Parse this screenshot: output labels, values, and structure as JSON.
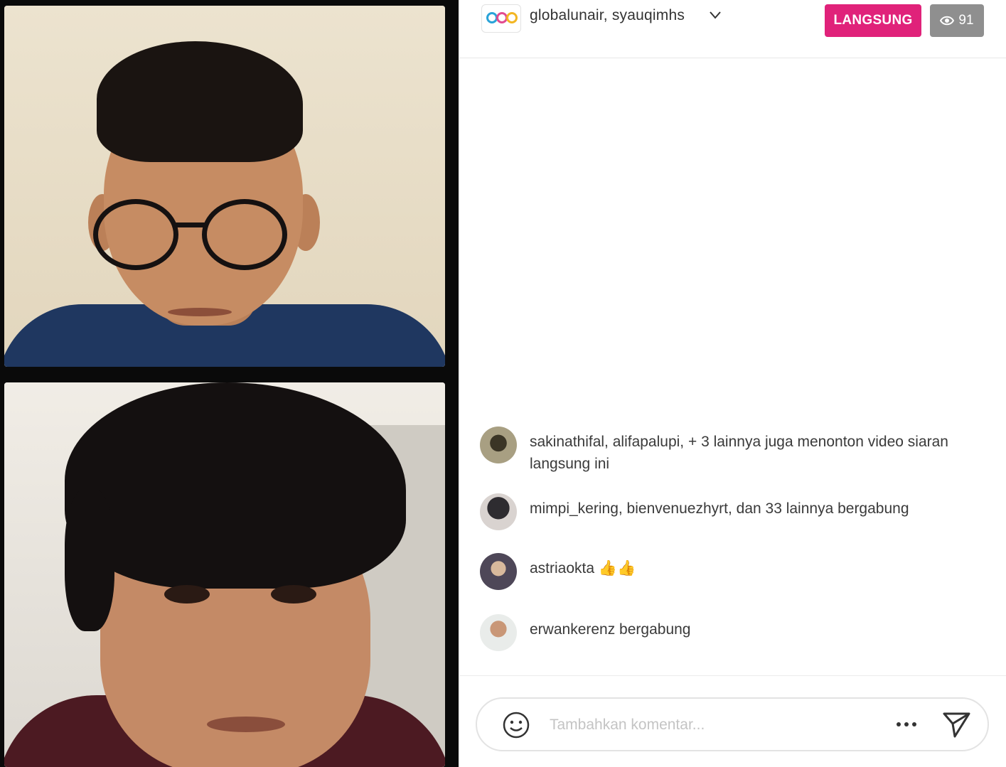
{
  "header": {
    "host_names": "globalunair, syauqimhs",
    "live_label": "LANGSUNG",
    "viewer_count": "91"
  },
  "comments": [
    {
      "text": "sakinathifal, alifapalupi, + 3 lainnya juga menonton video siaran langsung ini"
    },
    {
      "text": "mimpi_kering, bienvenuezhyrt, dan 33 lainnya bergabung"
    },
    {
      "text": "astriaokta 👍👍"
    },
    {
      "text": "erwankerenz bergabung"
    }
  ],
  "composer": {
    "placeholder": "Tambahkan komentar..."
  },
  "colors": {
    "live_badge": "#e0227a",
    "viewer_badge": "#8f8f8f"
  },
  "icons": [
    "chevron-down-icon",
    "eye-icon",
    "emoji-icon",
    "more-icon",
    "send-icon"
  ]
}
